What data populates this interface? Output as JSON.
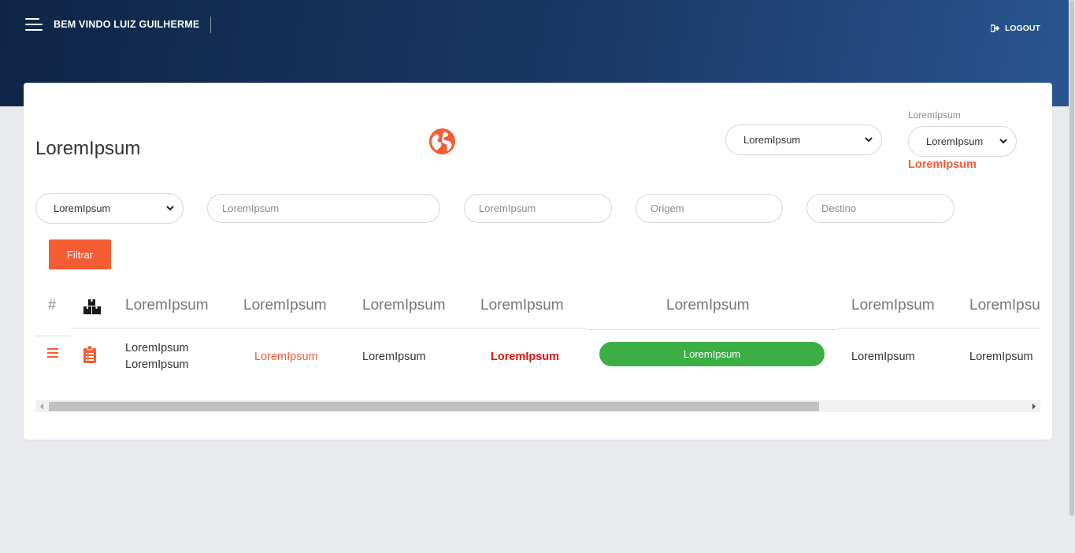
{
  "header": {
    "welcome_text": "BEM VINDO LUIZ GUILHERME",
    "logout_label": "LOGOUT"
  },
  "colors": {
    "header_dark": "#0f2547",
    "header_light": "#2a5590",
    "accent_orange": "#f45c33",
    "status_green": "#3bae44",
    "alert_red": "#e0140e"
  },
  "card": {
    "title": "LoremIpsum",
    "top_select_1": "LoremIpsum",
    "top_label": "LoremIpsum",
    "top_select_2": "LoremIpsum",
    "top_highlight": "LoremIpsum"
  },
  "filters": {
    "select_value": "LoremIpsum",
    "input_1_placeholder": "LoremIpsum",
    "input_2_placeholder": "LoremIpsum",
    "origem_placeholder": "Origem",
    "destino_placeholder": "Destino",
    "button_label": "Filtrar"
  },
  "table": {
    "hash": "#",
    "headers": [
      "LoremIpsum",
      "LoremIpsum",
      "LoremIpsum",
      "LoremIpsum",
      "LoremIpsum",
      "LoremIpsum",
      "LoremIpsu"
    ],
    "rows": [
      {
        "col1_line1": "LoremIpsum",
        "col1_line2": "LoremIpsum",
        "col2": "LoremIpsum",
        "col3": "LoremIpsum",
        "col4": "LoremIpsum",
        "status": "LoremIpsum",
        "col6": "LoremIpsum",
        "col7": "LoremIpsum"
      }
    ]
  },
  "icons": {
    "menu": "hamburger-icon",
    "logout": "sign-out-icon",
    "globe": "globe-icon",
    "boxes": "boxes-icon",
    "row_menu": "bars-icon",
    "clipboard": "clipboard-list-icon"
  }
}
